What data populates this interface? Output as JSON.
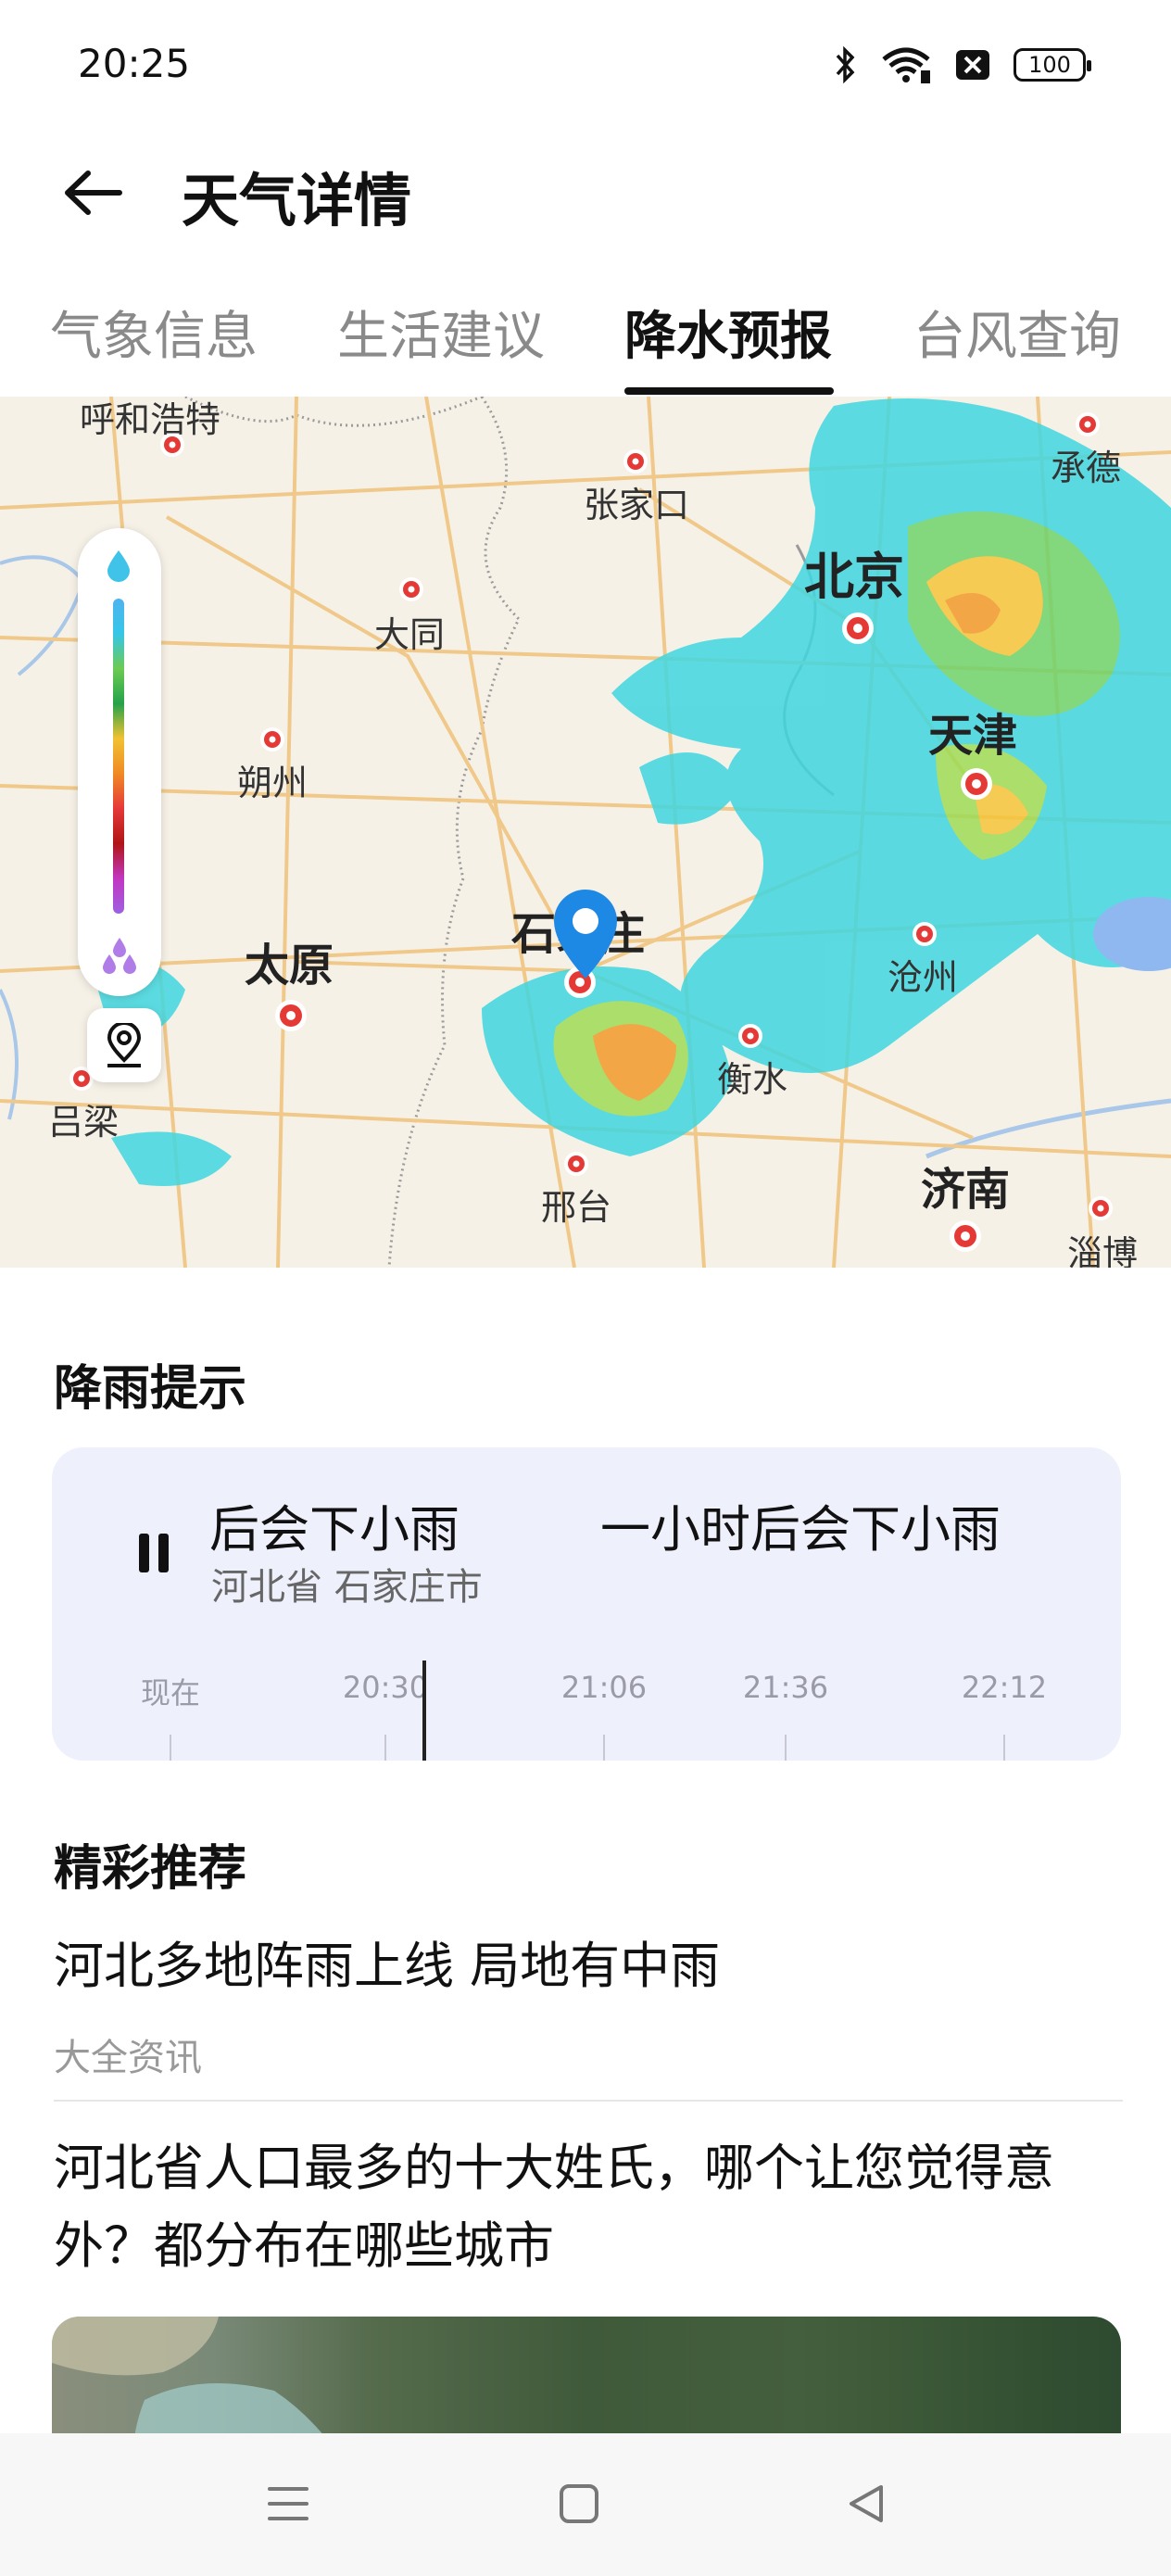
{
  "status_bar": {
    "time": "20:25",
    "battery": "100"
  },
  "header": {
    "title": "天气详情"
  },
  "tabs": [
    {
      "label": "气象信息",
      "active": false
    },
    {
      "label": "生活建议",
      "active": false
    },
    {
      "label": "降水预报",
      "active": true
    },
    {
      "label": "台风查询",
      "active": false
    }
  ],
  "map": {
    "cities": {
      "huhehaote": "呼和浩特",
      "chengde": "承德",
      "zhangjiakou": "张家口",
      "beijing": "北京",
      "datong": "大同",
      "tianjin": "天津",
      "shuozhou": "朔州",
      "shijiazhuang": "石家庄",
      "taiyuan": "太原",
      "cangzhou": "沧州",
      "hengshui": "衡水",
      "lvliang": "吕梁",
      "xingtai": "邢台",
      "jinan": "济南",
      "zibo": "淄博"
    }
  },
  "rain_alert": {
    "section_title": "降雨提示",
    "headline_short": "后会下小雨",
    "headline_long": "一小时后会下小雨",
    "location": "河北省 石家庄市",
    "timeline": [
      "现在",
      "20:30",
      "21:06",
      "21:36",
      "22:12"
    ]
  },
  "recommend": {
    "section_title": "精彩推荐",
    "articles": [
      {
        "title": "河北多地阵雨上线 局地有中雨",
        "source": "大全资讯"
      },
      {
        "title": "河北省人口最多的十大姓氏，哪个让您觉得意外？都分布在哪些城市"
      }
    ]
  },
  "colors": {
    "accent": "#1e88e5",
    "card_bg": "#eef0fc",
    "city_marker": "#e53935"
  }
}
